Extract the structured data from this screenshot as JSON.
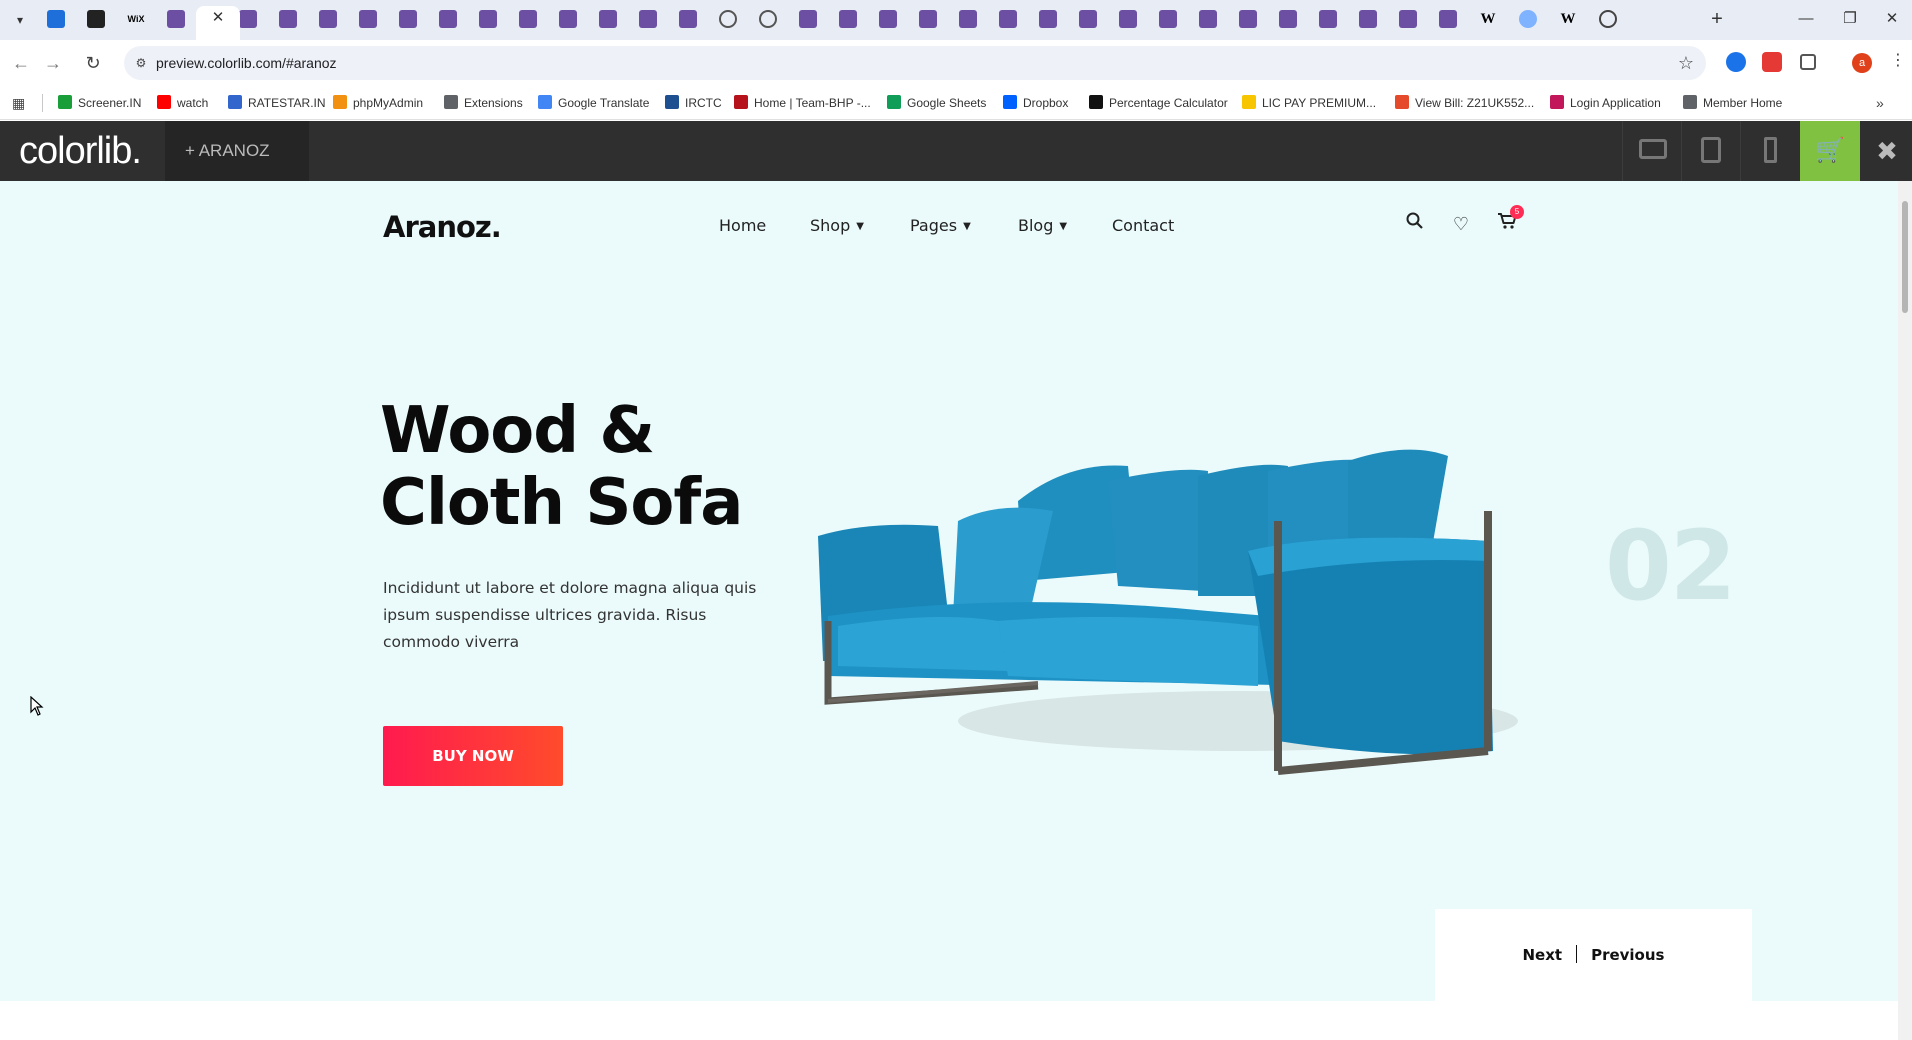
{
  "browser": {
    "url": "preview.colorlib.com/#aranoz",
    "tab_favicons": [
      "blue-app",
      "dark-app",
      "wix",
      "colorlib",
      "active",
      "colorlib",
      "colorlib",
      "colorlib",
      "colorlib",
      "colorlib",
      "colorlib",
      "colorlib",
      "colorlib",
      "colorlib",
      "colorlib",
      "colorlib",
      "colorlib",
      "globe",
      "globe",
      "colorlib",
      "colorlib",
      "colorlib",
      "colorlib",
      "colorlib",
      "colorlib",
      "colorlib",
      "colorlib",
      "colorlib",
      "colorlib",
      "colorlib",
      "colorlib",
      "colorlib",
      "colorlib",
      "colorlib",
      "colorlib",
      "colorlib",
      "wikipedia",
      "un",
      "wikipedia",
      "chatgpt"
    ],
    "profile_initial": "a"
  },
  "bookmarks": [
    {
      "label": "Screener.IN",
      "color": "#1a9e3a"
    },
    {
      "label": "watch",
      "color": "#ff0000"
    },
    {
      "label": "RATESTAR.IN",
      "color": "#3366cc"
    },
    {
      "label": "phpMyAdmin",
      "color": "#f29111"
    },
    {
      "label": "Extensions",
      "color": "#5f6368"
    },
    {
      "label": "Google Translate",
      "color": "#4285f4"
    },
    {
      "label": "IRCTC",
      "color": "#1d4f91"
    },
    {
      "label": "Home | Team-BHP -...",
      "color": "#b5121b"
    },
    {
      "label": "Google Sheets",
      "color": "#0f9d58"
    },
    {
      "label": "Dropbox",
      "color": "#0061fe"
    },
    {
      "label": "Percentage Calculator",
      "color": "#111111"
    },
    {
      "label": "LIC PAY PREMIUM...",
      "color": "#f7c600"
    },
    {
      "label": "View Bill: Z21UK552...",
      "color": "#e54b2b"
    },
    {
      "label": "Login Application",
      "color": "#c2185b"
    },
    {
      "label": "Member Home",
      "color": "#5f6368"
    }
  ],
  "colorlib": {
    "logo": "colorlib.",
    "theme_label": "+ ARANOZ",
    "accent": "#80c141"
  },
  "site": {
    "brand": "Aranoz.",
    "nav": [
      {
        "label": "Home",
        "dropdown": false
      },
      {
        "label": "Shop",
        "dropdown": true
      },
      {
        "label": "Pages",
        "dropdown": true
      },
      {
        "label": "Blog",
        "dropdown": true
      },
      {
        "label": "Contact",
        "dropdown": false
      }
    ],
    "cart_count": "5"
  },
  "hero": {
    "title_line1": "Wood &",
    "title_line2": "Cloth Sofa",
    "text": "Incididunt ut labore et dolore magna aliqua quis ipsum suspendisse ultrices gravida. Risus commodo viverra",
    "button": "BUY NOW",
    "slide_number": "02",
    "button_color": "#ff1a4f",
    "background": "#ebfbfb"
  },
  "pager": {
    "next": "Next",
    "previous": "Previous"
  }
}
